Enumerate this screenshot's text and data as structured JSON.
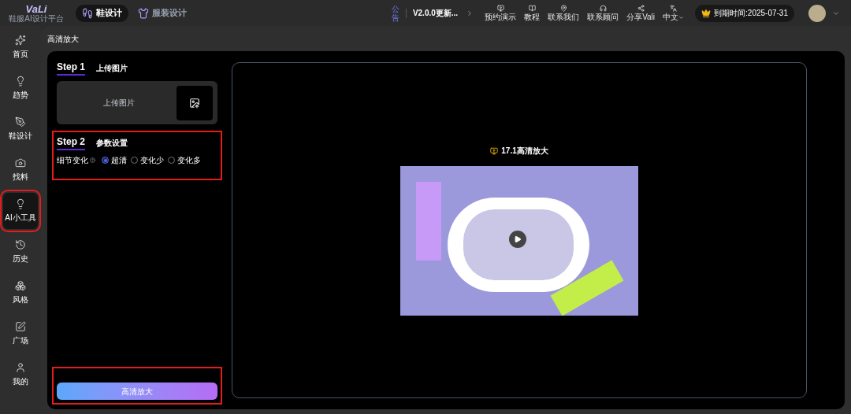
{
  "header": {
    "logo": "VaLi",
    "logo_subtitle": "鞋服AI设计平台",
    "top_tabs": [
      {
        "label": "鞋设计",
        "selected": true
      },
      {
        "label": "服装设计",
        "selected": false
      }
    ],
    "announcement": {
      "label": "公告",
      "text": "V2.0.0更新..."
    },
    "toolbar": [
      {
        "label": "预约演示"
      },
      {
        "label": "教程"
      },
      {
        "label": "联系我们"
      },
      {
        "label": "联系顾问"
      },
      {
        "label": "分享Vali"
      }
    ],
    "language": "中文",
    "expiry": "到期时间:2025-07-31"
  },
  "sidebar": {
    "items": [
      {
        "label": "首页",
        "selected": false,
        "highlighted": false
      },
      {
        "label": "趋势",
        "selected": false,
        "highlighted": false
      },
      {
        "label": "鞋设计",
        "selected": false,
        "highlighted": false
      },
      {
        "label": "找料",
        "selected": false,
        "highlighted": false
      },
      {
        "label": "AI小工具",
        "selected": true,
        "highlighted": true
      },
      {
        "label": "历史",
        "selected": false,
        "highlighted": false
      },
      {
        "label": "风格",
        "selected": false,
        "highlighted": false
      },
      {
        "label": "广场",
        "selected": false,
        "highlighted": false
      },
      {
        "label": "我的",
        "selected": false,
        "highlighted": false
      }
    ]
  },
  "breadcrumb": "高清放大",
  "step1": {
    "step": "Step 1",
    "title": "上传图片",
    "upload_label": "上传图片",
    "highlighted": false
  },
  "step2": {
    "step": "Step 2",
    "title": "参数设置",
    "highlighted": true,
    "field_label": "细节变化",
    "options": [
      {
        "label": "超清",
        "selected": true
      },
      {
        "label": "变化少",
        "selected": false
      },
      {
        "label": "变化多",
        "selected": false
      }
    ]
  },
  "action": {
    "label": "高清放大",
    "highlighted": true
  },
  "preview": {
    "title": "17.1高清放大"
  }
}
